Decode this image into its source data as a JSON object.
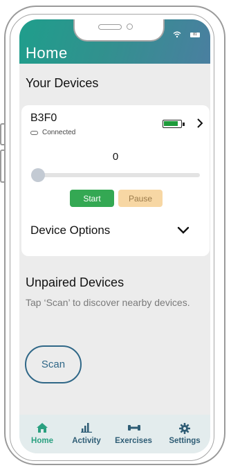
{
  "status_bar": {
    "battery_text": "81"
  },
  "header": {
    "title": "Home"
  },
  "devices_section": {
    "title": "Your Devices"
  },
  "device": {
    "name": "B3F0",
    "connection_status": "Connected",
    "value": "0",
    "slider_level": 0,
    "battery_level": 0.85,
    "start_label": "Start",
    "pause_label": "Pause",
    "options_label": "Device Options"
  },
  "unpaired": {
    "title": "Unpaired Devices",
    "description": "Tap ‘Scan’ to discover nearby devices.",
    "scan_label": "Scan"
  },
  "tabs": [
    {
      "label": "Home",
      "icon": "home-icon",
      "active": true
    },
    {
      "label": "Activity",
      "icon": "bar-chart-icon",
      "active": false
    },
    {
      "label": "Exercises",
      "icon": "dumbbell-icon",
      "active": false
    },
    {
      "label": "Settings",
      "icon": "gear-icon",
      "active": false
    }
  ],
  "colors": {
    "header_start": "#1f9e8c",
    "header_end": "#4a7fa0",
    "start_green": "#34a853",
    "pause_peach": "#f7d7a4",
    "battery_green": "#1e9a3a",
    "scan_blue": "#2f6787",
    "tab_active": "#2aa080",
    "tab_inactive": "#2f5d75"
  }
}
